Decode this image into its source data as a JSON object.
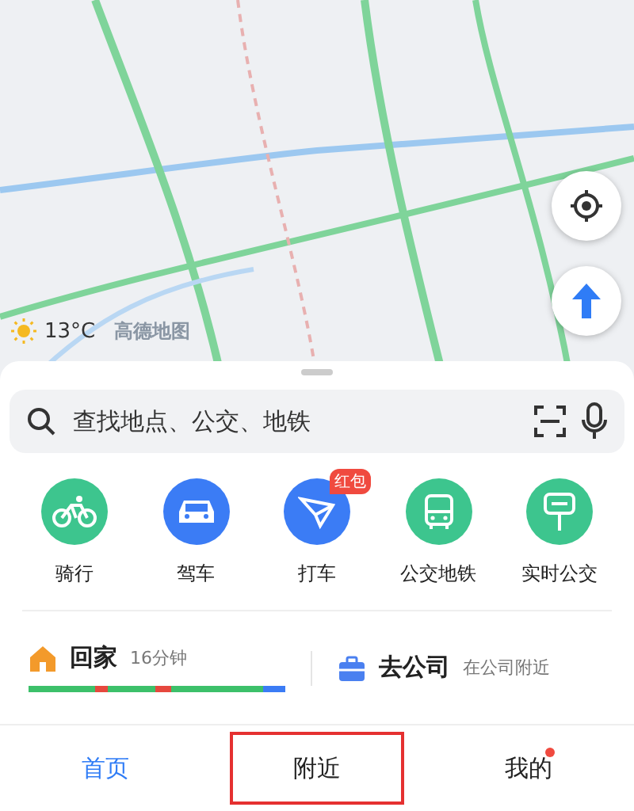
{
  "map": {
    "kind": "picture",
    "weather": {
      "temperature": "13°C"
    },
    "logo": "高德地图"
  },
  "search": {
    "placeholder": "查找地点、公交、地铁"
  },
  "shortcuts": [
    {
      "label": "骑行",
      "kind": "bike",
      "color": "#3dc58e"
    },
    {
      "label": "驾车",
      "kind": "car",
      "color": "#3b7cf5"
    },
    {
      "label": "打车",
      "kind": "taxi",
      "color": "#3b7cf5",
      "badge": "红包"
    },
    {
      "label": "公交地铁",
      "kind": "bus",
      "color": "#3dc58e"
    },
    {
      "label": "实时公交",
      "kind": "stop",
      "color": "#3dc58e"
    }
  ],
  "commute": [
    {
      "kind": "home",
      "title": "回家",
      "note": "16分钟"
    },
    {
      "kind": "work",
      "title": "去公司",
      "note": "在公司附近"
    }
  ],
  "tabs": [
    {
      "label": "首页",
      "selected": true,
      "dot": false,
      "highlighted": false
    },
    {
      "label": "附近",
      "selected": false,
      "dot": false,
      "highlighted": true
    },
    {
      "label": "我的",
      "selected": false,
      "dot": true,
      "highlighted": false
    }
  ]
}
